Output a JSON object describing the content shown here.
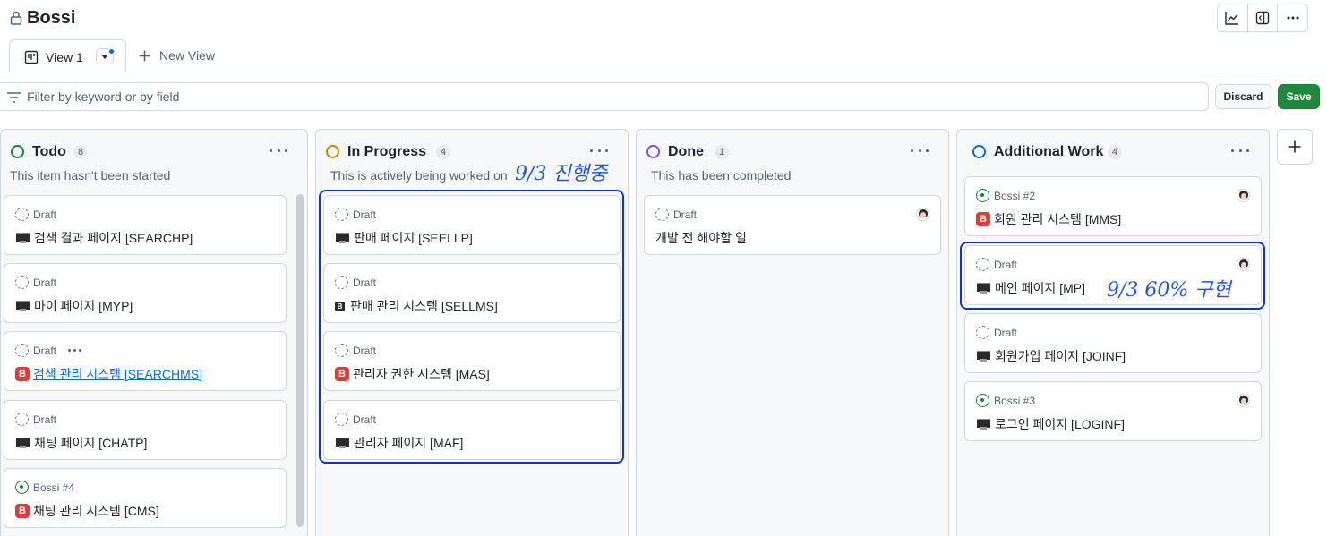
{
  "header": {
    "title": "Bossi"
  },
  "tabs": {
    "active_label": "View 1",
    "new_view_label": "New View"
  },
  "filter": {
    "placeholder": "Filter by keyword or by field",
    "discard_label": "Discard",
    "save_label": "Save"
  },
  "colors": {
    "todo": "#1a7f37",
    "in_progress": "#bf8700",
    "done": "#8250df",
    "additional": "#0969da",
    "annotation": "#1e55e8"
  },
  "columns": [
    {
      "name": "Todo",
      "count": "8",
      "description": "This item hasn't been started",
      "cards": [
        {
          "status": "Draft",
          "icon": "desktop-computer-icon",
          "title": "검색 결과 페이지 [SEARCHP]"
        },
        {
          "status": "Draft",
          "icon": "desktop-computer-icon",
          "title": "마이 페이지 [MYP]"
        },
        {
          "status": "Draft",
          "icon": "b-button-icon",
          "title": "검색 관리 시스템 [SEARCHMS]"
        },
        {
          "status": "Draft",
          "icon": "desktop-computer-icon",
          "title": "채팅 페이지 [CHATP]"
        },
        {
          "status": "Bossi #4",
          "icon": "b-button-icon",
          "title": "채팅 관리 시스템 [CMS]"
        }
      ]
    },
    {
      "name": "In Progress",
      "count": "4",
      "description": "This is actively being worked on",
      "cards": [
        {
          "status": "Draft",
          "icon": "desktop-computer-icon",
          "title": "판매 페이지 [SEELLP]"
        },
        {
          "status": "Draft",
          "icon": "b-button-icon",
          "title": "판매 관리 시스템 [SELLMS]"
        },
        {
          "status": "Draft",
          "icon": "b-button-icon",
          "title": "관리자 권한 시스템 [MAS]"
        },
        {
          "status": "Draft",
          "icon": "desktop-computer-icon",
          "title": "관리자 페이지 [MAF]"
        }
      ]
    },
    {
      "name": "Done",
      "count": "1",
      "description": "This has been completed",
      "cards": [
        {
          "status": "Draft",
          "title": "개발 전 해야할 일"
        }
      ]
    },
    {
      "name": "Additional Work",
      "count": "4",
      "description": "",
      "cards": [
        {
          "status": "Bossi #2",
          "icon": "b-button-icon",
          "title": "회원 관리 시스템 [MMS]"
        },
        {
          "status": "Draft",
          "icon": "desktop-computer-icon",
          "title": "메인 페이지 [MP]"
        },
        {
          "status": "Draft",
          "icon": "desktop-computer-icon",
          "title": "회원가입 페이지 [JOINF]"
        },
        {
          "status": "Bossi #3",
          "icon": "desktop-computer-icon",
          "title": "로그인 페이지 [LOGINF]"
        }
      ]
    }
  ],
  "annotations": {
    "in_progress_note": "9/3 진행중",
    "main_page_note": "9/3  60% 구현"
  }
}
